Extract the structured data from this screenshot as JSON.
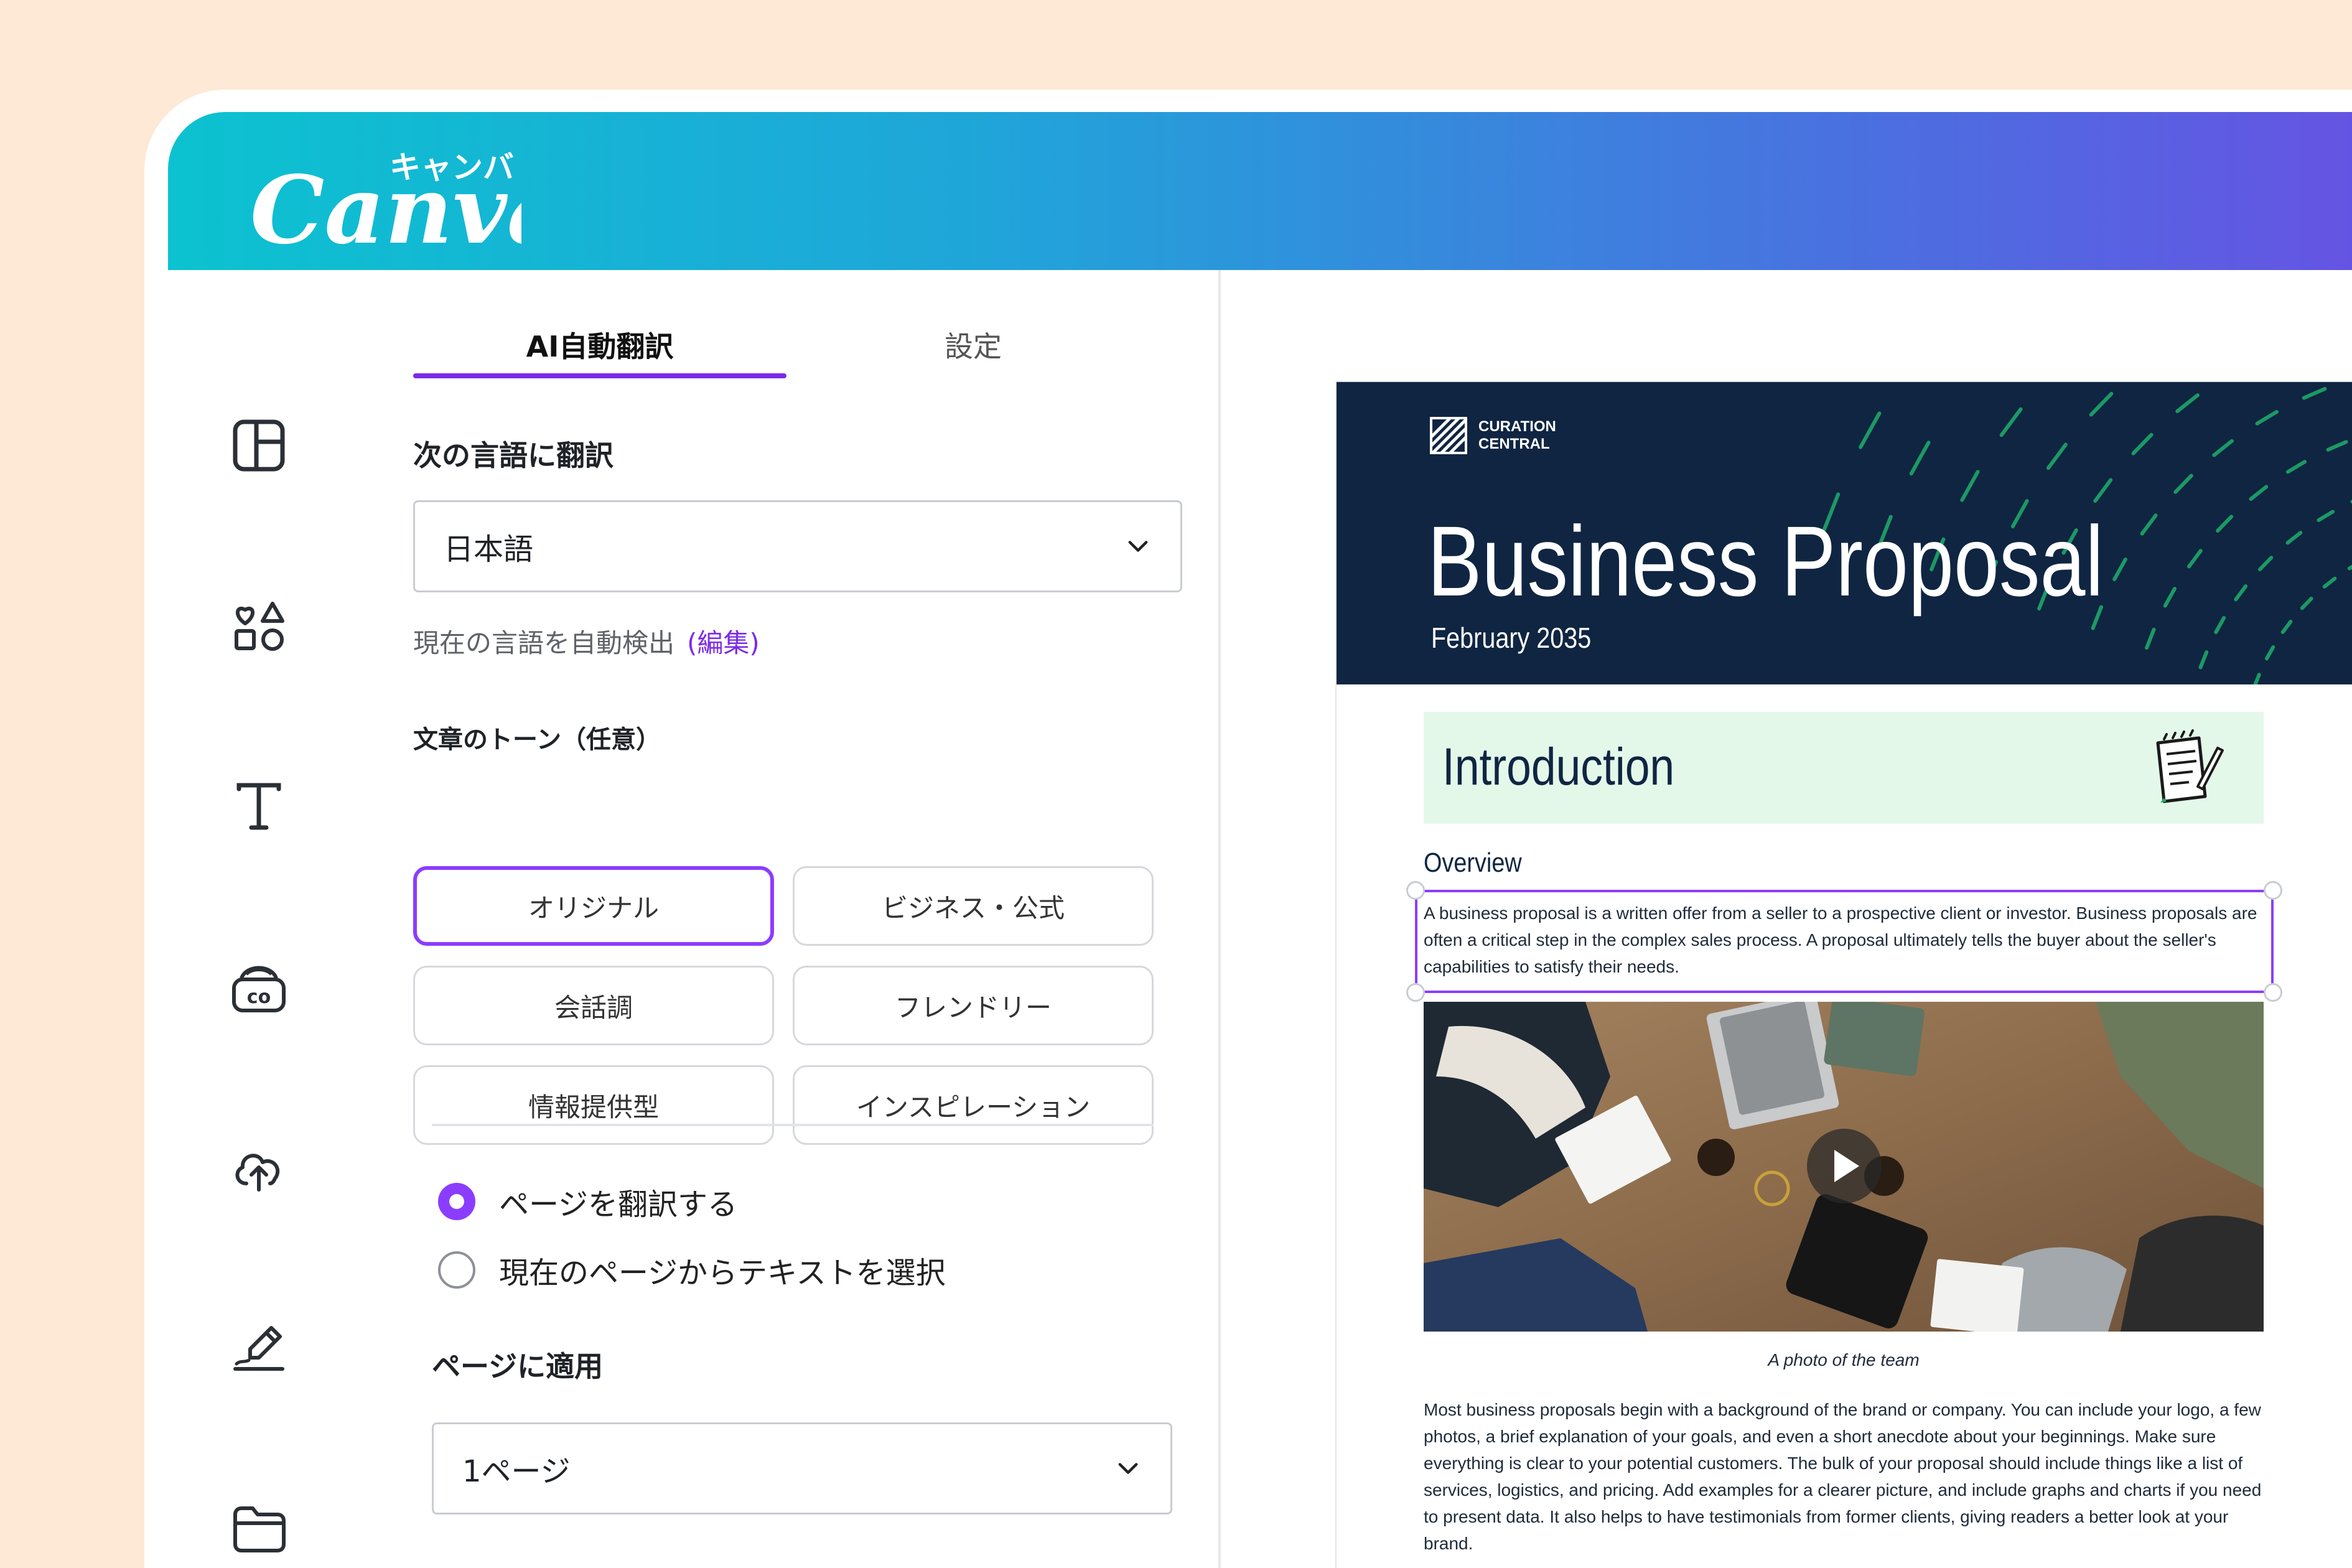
{
  "app": {
    "logo_text": "Canva",
    "logo_kana": "キャンバ",
    "brand_gradient": [
      "#0cc2d0",
      "#6a4fe4"
    ],
    "accent": "#8b3dff"
  },
  "rail": {
    "icons": [
      "layout-icon",
      "elements-icon",
      "text-icon",
      "brand-icon",
      "upload-icon",
      "draw-icon",
      "folder-icon"
    ]
  },
  "panel": {
    "tabs": [
      {
        "label": "AI自動翻訳",
        "active": true
      },
      {
        "label": "設定",
        "active": false
      }
    ],
    "translate_to_label": "次の言語に翻訳",
    "language_select": {
      "value": "日本語"
    },
    "autodetect_hint": "現在の言語を自動検出",
    "edit_link": "(編集)",
    "tone_label": "文章のトーン（任意）",
    "tones": [
      {
        "label": "オリジナル",
        "active": true
      },
      {
        "label": "ビジネス・公式",
        "active": false
      },
      {
        "label": "会話調",
        "active": false
      },
      {
        "label": "フレンドリー",
        "active": false
      },
      {
        "label": "情報提供型",
        "active": false
      },
      {
        "label": "インスピレーション",
        "active": false
      }
    ],
    "scope_options": [
      {
        "label": "ページを翻訳する",
        "selected": true
      },
      {
        "label": "現在のページからテキストを選択",
        "selected": false
      }
    ],
    "apply_label": "ページに適用",
    "page_select": {
      "value": "1ページ"
    }
  },
  "document": {
    "brand_line1": "CURATION",
    "brand_line2": "CENTRAL",
    "title": "Business Proposal",
    "date": "February 2035",
    "hero_color": "#0f2542",
    "section_title": "Introduction",
    "subheading": "Overview",
    "paragraph1": "A business proposal is a written offer from a seller to a prospective client or investor. Business proposals are often a critical step in the complex sales process. A proposal ultimately tells the buyer about the seller's capabilities to satisfy their needs.",
    "photo_caption": "A photo of the team",
    "paragraph2": "Most business proposals begin with a background of the brand or company. You can include your logo, a few photos, a brief explanation of your goals, and even a short anecdote about your beginnings. Make sure everything is clear to your potential customers. The bulk of your proposal should include things like a list of services, logistics, and pricing. Add examples for a clearer picture, and include graphs and charts if you need to present data. It also helps to have testimonials from former clients, giving readers a better look at your brand."
  }
}
